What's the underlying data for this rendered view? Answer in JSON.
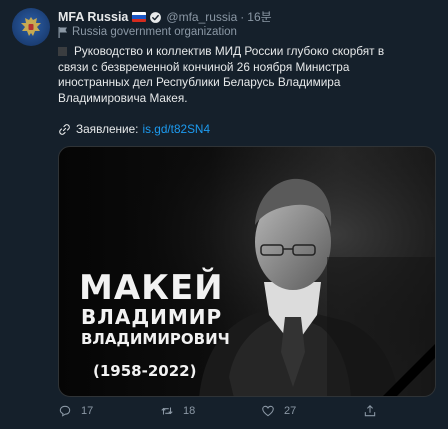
{
  "tweet": {
    "author_name": "MFA Russia",
    "handle": "@mfa_russia",
    "time": "16분",
    "org_label": "Russia government organization",
    "text": "Руководство и коллектив МИД России глубоко скорбят в связи с безвременной кончиной 26 ноября Министра иностранных дел Республики Беларусь Владимира Владимировича Макея.",
    "link_label": "Заявление:",
    "link_url": "is.gd/t82SN4"
  },
  "media": {
    "last_name": "МАКЕЙ",
    "first_name": "ВЛАДИМИР",
    "patronymic": "ВЛАДИМИРОВИЧ",
    "years": "(1958-2022)"
  },
  "actions": {
    "replies": "17",
    "retweets": "18",
    "likes": "27"
  },
  "colors": {
    "background": "#15202b",
    "text": "#e7e9ea",
    "muted": "#8b98a5",
    "link": "#1d9bf0"
  },
  "icons": [
    "emblem-avatar-icon",
    "russia-flag-icon",
    "verified-badge-icon",
    "government-flag-icon",
    "link-icon",
    "mourning-ribbon-icon",
    "reply-icon",
    "retweet-icon",
    "like-icon",
    "share-icon"
  ]
}
